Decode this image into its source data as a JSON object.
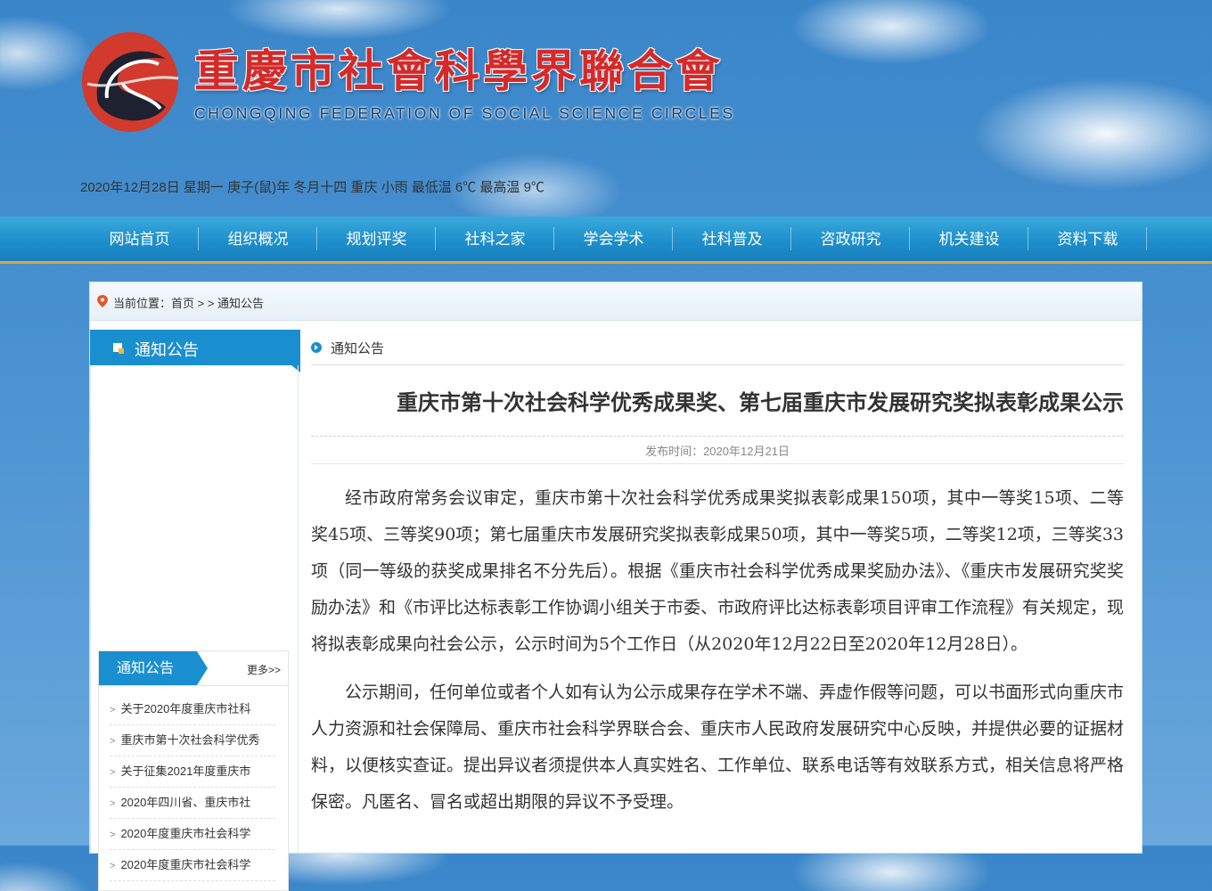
{
  "header": {
    "title": "重慶市社會科學界聯合會",
    "subtitle": "CHONGQING FEDERATION OF SOCIAL SCIENCE CIRCLES",
    "date_line": "2020年12月28日 星期一 庚子(鼠)年 冬月十四   重庆  小雨  最低温 6℃  最高温 9℃"
  },
  "nav": {
    "items": [
      "网站首页",
      "组织概况",
      "规划评奖",
      "社科之家",
      "学会学术",
      "社科普及",
      "咨政研究",
      "机关建设",
      "资料下载"
    ]
  },
  "breadcrumb": {
    "text": "当前位置：首页 > > 通知公告"
  },
  "sidebar": {
    "heading": "通知公告",
    "news_box": {
      "tab": "通知公告",
      "more": "更多>>",
      "items": [
        "关于2020年度重庆市社科",
        "重庆市第十次社会科学优秀",
        "关于征集2021年度重庆市",
        "2020年四川省、重庆市社",
        "2020年度重庆市社会科学",
        "2020年度重庆市社会科学"
      ]
    }
  },
  "content": {
    "section_label": "通知公告",
    "title": "重庆市第十次社会科学优秀成果奖、第七届重庆市发展研究奖拟表彰成果公示",
    "publish_time": "发布时间：2020年12月21日",
    "paragraphs": [
      "经市政府常务会议审定，重庆市第十次社会科学优秀成果奖拟表彰成果150项，其中一等奖15项、二等奖45项、三等奖90项；第七届重庆市发展研究奖拟表彰成果50项，其中一等奖5项，二等奖12项，三等奖33项（同一等级的获奖成果排名不分先后）。根据《重庆市社会科学优秀成果奖励办法》、《重庆市发展研究奖奖励办法》和《市评比达标表彰工作协调小组关于市委、市政府评比达标表彰项目评审工作流程》有关规定，现将拟表彰成果向社会公示，公示时间为5个工作日（从2020年12月22日至2020年12月28日）。",
      "公示期间，任何单位或者个人如有认为公示成果存在学术不端、弄虚作假等问题，可以书面形式向重庆市人力资源和社会保障局、重庆市社会科学界联合会、重庆市人民政府发展研究中心反映，并提供必要的证据材料，以便核实查证。提出异议者须提供本人真实姓名、工作单位、联系电话等有效联系方式，相关信息将严格保密。凡匿名、冒名或超出期限的异议不予受理。"
    ]
  }
}
